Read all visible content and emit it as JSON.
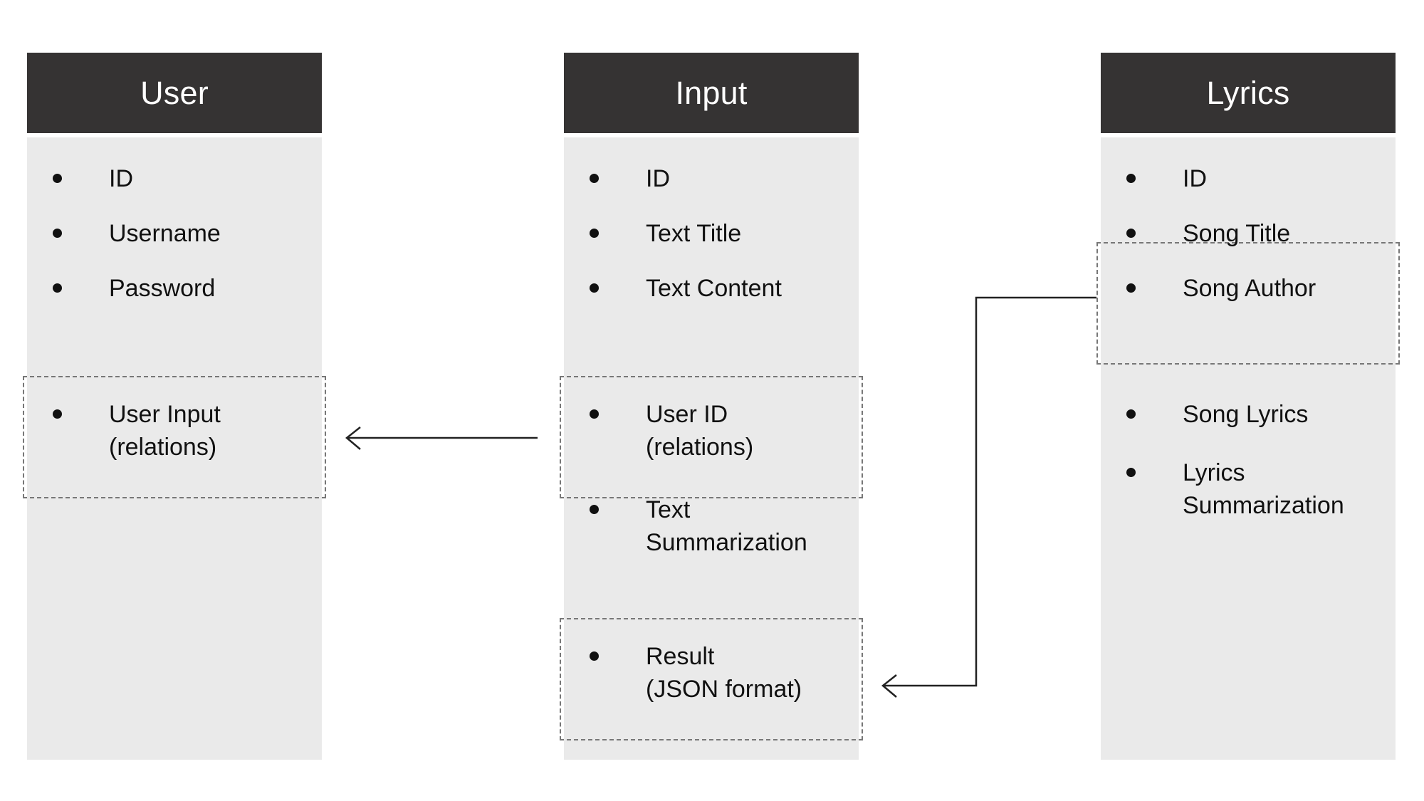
{
  "diagram": {
    "title": "Entity relationship diagram",
    "colors": {
      "header_background": "#353333",
      "header_text": "#ffffff",
      "body_background": "#eaeaea",
      "field_text": "#111111",
      "dashed_border": "#777777",
      "connector_line": "#222222",
      "page_background": "#ffffff"
    },
    "entities": [
      {
        "name": "user",
        "title": "User",
        "fields": [
          {
            "key": "id",
            "label": "ID",
            "highlighted": false
          },
          {
            "key": "username",
            "label": "Username",
            "highlighted": false
          },
          {
            "key": "password",
            "label": "Password",
            "highlighted": false
          },
          {
            "key": "user_input",
            "label": "User Input\n(relations)",
            "highlighted": true
          }
        ]
      },
      {
        "name": "input",
        "title": "Input",
        "fields": [
          {
            "key": "id",
            "label": "ID",
            "highlighted": false
          },
          {
            "key": "text_title",
            "label": "Text Title",
            "highlighted": false
          },
          {
            "key": "text_content",
            "label": "Text Content",
            "highlighted": false
          },
          {
            "key": "user_id",
            "label": "User ID\n(relations)",
            "highlighted": true
          },
          {
            "key": "text_summarization",
            "label": "Text\nSummarization",
            "highlighted": false
          },
          {
            "key": "result",
            "label": "Result\n(JSON format)",
            "highlighted": true
          }
        ]
      },
      {
        "name": "lyrics",
        "title": "Lyrics",
        "fields": [
          {
            "key": "id",
            "label": "ID",
            "highlighted": false
          },
          {
            "key": "song_title",
            "label": "Song Title",
            "highlighted": true
          },
          {
            "key": "song_author",
            "label": "Song Author",
            "highlighted": true
          },
          {
            "key": "song_lyrics",
            "label": "Song Lyrics",
            "highlighted": false
          },
          {
            "key": "lyrics_summarization",
            "label": "Lyrics\nSummarization",
            "highlighted": false
          }
        ]
      }
    ],
    "relations": [
      {
        "name": "input-to-user",
        "from": "input.user_id",
        "to": "user.user_input",
        "style": "straight-arrow-left"
      },
      {
        "name": "lyrics-to-input",
        "from": "lyrics.song_title_author",
        "to": "input.result",
        "style": "stepped-arrow-left"
      }
    ]
  }
}
